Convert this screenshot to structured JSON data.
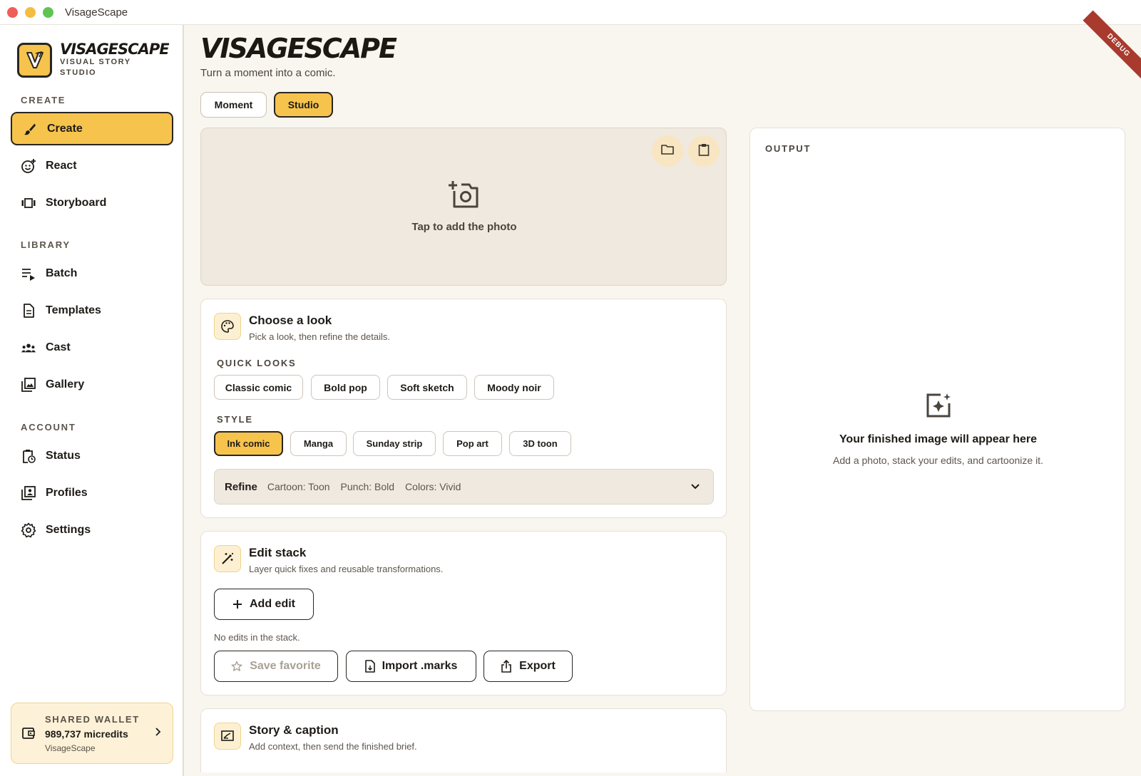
{
  "window": {
    "title": "VisageScape"
  },
  "brand": {
    "name": "VISAGESCAPE",
    "subtitle": "VISUAL STORY STUDIO"
  },
  "sidebar": {
    "sections": [
      {
        "label": "CREATE"
      },
      {
        "label": "LIBRARY"
      },
      {
        "label": "ACCOUNT"
      }
    ],
    "items": [
      {
        "label": "Create",
        "icon": "brush-icon",
        "active": true
      },
      {
        "label": "React",
        "icon": "emoji-add-icon"
      },
      {
        "label": "Storyboard",
        "icon": "carousel-icon"
      },
      {
        "label": "Batch",
        "icon": "playlist-play-icon"
      },
      {
        "label": "Templates",
        "icon": "document-icon"
      },
      {
        "label": "Cast",
        "icon": "group-icon"
      },
      {
        "label": "Gallery",
        "icon": "photo-library-icon"
      },
      {
        "label": "Status",
        "icon": "clipboard-clock-icon"
      },
      {
        "label": "Profiles",
        "icon": "portrait-icon"
      },
      {
        "label": "Settings",
        "icon": "gear-icon"
      }
    ],
    "wallet": {
      "label": "SHARED WALLET",
      "value": "989,737 micredits",
      "org": "VisageScape"
    }
  },
  "header": {
    "title": "VISAGESCAPE",
    "tagline": "Turn a moment into a comic."
  },
  "modes": {
    "moment": "Moment",
    "studio": "Studio",
    "selected": "Studio"
  },
  "debug_label": "DEBUG",
  "dropzone": {
    "prompt": "Tap to add the photo"
  },
  "look": {
    "title": "Choose a look",
    "subtitle": "Pick a look, then refine the details.",
    "quick_label": "QUICK LOOKS",
    "quick": [
      "Classic comic",
      "Bold pop",
      "Soft sketch",
      "Moody noir"
    ],
    "style_label": "STYLE",
    "styles": [
      "Ink comic",
      "Manga",
      "Sunday strip",
      "Pop art",
      "3D toon"
    ],
    "selected_style": "Ink comic",
    "refine": {
      "title": "Refine",
      "items": [
        "Cartoon: Toon",
        "Punch: Bold",
        "Colors: Vivid"
      ]
    }
  },
  "edit_stack": {
    "title": "Edit stack",
    "subtitle": "Layer quick fixes and reusable transformations.",
    "add_label": "Add edit",
    "empty_text": "No edits in the stack.",
    "save_label": "Save favorite",
    "import_label": "Import .marks",
    "export_label": "Export"
  },
  "story": {
    "title": "Story & caption",
    "subtitle": "Add context, then send the finished brief."
  },
  "output": {
    "label": "OUTPUT",
    "empty_title": "Your finished image will appear here",
    "empty_subtitle": "Add a photo, stack your edits, and cartoonize it."
  },
  "colors": {
    "accent": "#f6c34c",
    "ink": "#2a2520",
    "canvas": "#f9f6f0"
  }
}
